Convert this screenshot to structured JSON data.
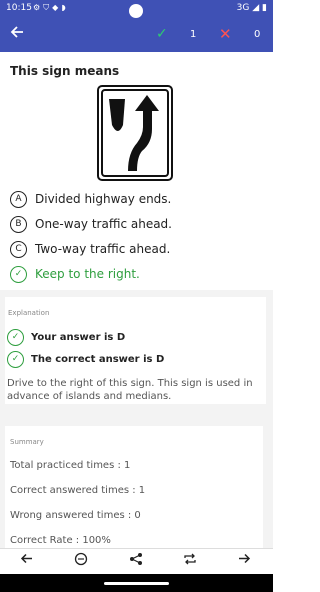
{
  "status_bar": {
    "time": "10:15",
    "network": "3G"
  },
  "app_bar": {
    "correct_count": "1",
    "wrong_count": "0"
  },
  "question": {
    "title": "This sign means",
    "options": [
      {
        "letter": "A",
        "text": "Divided highway ends."
      },
      {
        "letter": "B",
        "text": "One-way traffic ahead."
      },
      {
        "letter": "C",
        "text": "Two-way traffic ahead."
      },
      {
        "letter": "✓",
        "text": "Keep to the right."
      }
    ]
  },
  "explanation": {
    "heading": "Explanation",
    "your_answer": "Your answer is D",
    "correct_answer": "The correct answer is D",
    "text": "Drive to the right of this sign. This sign is used in advance of islands and medians."
  },
  "summary": {
    "heading": "Summary",
    "total_practiced": "Total practiced times : 1",
    "correct_answered": "Correct answered times : 1",
    "wrong_answered": "Wrong answered times : 0",
    "correct_rate": "Correct Rate : 100%"
  },
  "icons": {
    "back": "arrow-left-icon",
    "correct": "check-icon",
    "wrong": "close-icon",
    "prev": "arrow-left-icon",
    "assistant": "assistant-icon",
    "share": "share-icon",
    "repeat": "repeat-icon",
    "next": "arrow-right-icon"
  },
  "colors": {
    "primary": "#3f51b5",
    "correct": "#2e9e3e",
    "wrong": "#ff5252"
  }
}
